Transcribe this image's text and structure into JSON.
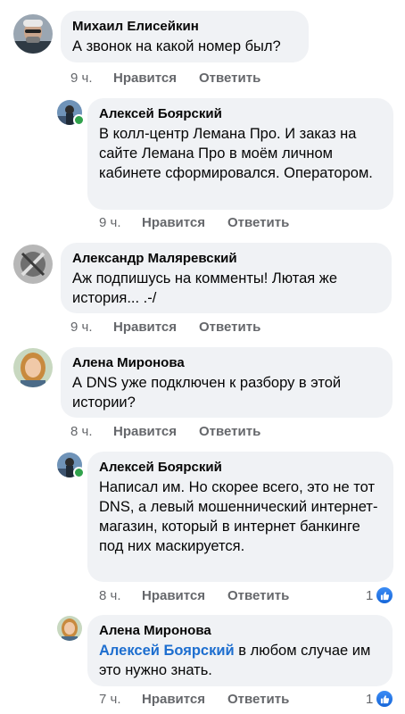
{
  "comments": [
    {
      "author": "Михаил Елисейкин",
      "text": "А звонок на какой номер был?",
      "time": "9 ч.",
      "like_label": "Нравится",
      "reply_label": "Ответить"
    },
    {
      "author": "Алексей Боярский",
      "text": "В колл-центр Лемана Про. И заказ на сайте Лемана Про в моём личном кабинете сформировался. Оператором.",
      "time": "9 ч.",
      "like_label": "Нравится",
      "reply_label": "Ответить"
    },
    {
      "author": "Александр Маляревский",
      "text": "Аж подпишусь на комменты! Лютая же история... .-/",
      "time": "9 ч.",
      "like_label": "Нравится",
      "reply_label": "Ответить"
    },
    {
      "author": "Алена Миронова",
      "text": "А DNS уже подключен к разбору в этой истории?",
      "time": "8 ч.",
      "like_label": "Нравится",
      "reply_label": "Ответить"
    },
    {
      "author": "Алексей Боярский",
      "text": "Написал им. Но скорее всего, это не тот DNS, а левый мошеннический интернет-магазин, который в интернет банкинге  под них маскируется.",
      "time": "8 ч.",
      "like_label": "Нравится",
      "reply_label": "Ответить",
      "reaction_count": "1"
    },
    {
      "author": "Алена Миронова",
      "mention": "Алексей Боярский",
      "text": " в любом случае им это нужно знать.",
      "time": "7 ч.",
      "like_label": "Нравится",
      "reply_label": "Ответить",
      "reaction_count": "1"
    }
  ],
  "colors": {
    "bubble": "#f0f2f5",
    "meta": "#65676b",
    "mention": "#1d6ecf",
    "like": "#1877f2",
    "online": "#31a24c"
  },
  "icons": {
    "reaction": "thumbs-up-icon",
    "presence": "online-dot"
  }
}
